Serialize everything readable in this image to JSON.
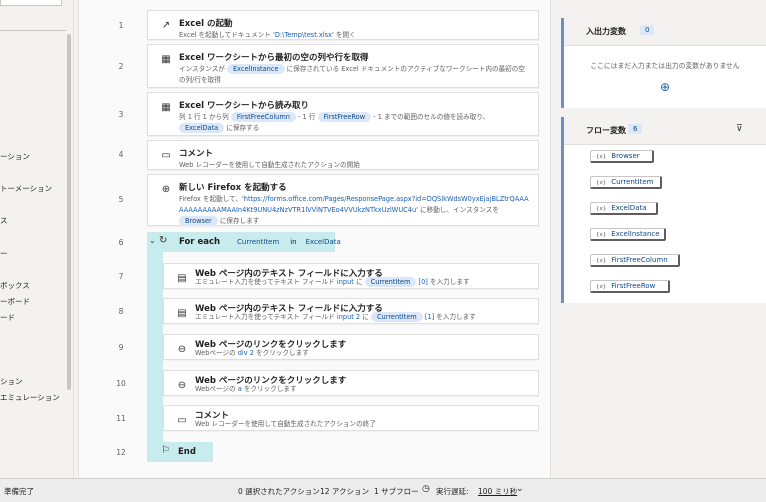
{
  "left_panel": {
    "items": [
      "ーション",
      "トーメーション",
      "ス",
      "ー",
      "ボックス",
      "ーボード",
      "ード",
      "ション",
      "エミュレーション"
    ]
  },
  "flow": {
    "steps": [
      {
        "num": "1",
        "title": "Excel の起動",
        "desc_parts": [
          "Excel を起動してドキュメント ",
          "'D:\\Temp\\test.xlsx'",
          " を開く"
        ]
      },
      {
        "num": "2",
        "title": "Excel ワークシートから最初の空の列や行を取得",
        "desc_a": "インスタンスが ",
        "tok1": "ExcelInstance",
        "desc_b": " に保存されている Excel ドキュメントのアクティブなワークシート内の最初の空の列/行を取得"
      },
      {
        "num": "3",
        "title": "Excel ワークシートから読み取り",
        "desc_a": "列 1 行 1 から列 ",
        "tok1": "FirstFreeColumn",
        "desc_b": " - 1 行 ",
        "tok2": "FirstFreeRow",
        "desc_c": " - 1 までの範囲のセルの値を読み取り、",
        "tok3": "ExcelData",
        "desc_d": " に保存する"
      },
      {
        "num": "4",
        "title": "コメント",
        "desc": "Web レコーダーを使用して自動生成されたアクションの開始"
      },
      {
        "num": "5",
        "title": "新しい Firefox を起動する",
        "desc_a": "Firefox を起動して、",
        "link": "'https://forms.office.com/Pages/ResponsePage.aspx?id=DQSIkWdsW0yxEjajBLZtrQAAAAAAAAAAAAMAAIn4Kt9UNU4zNzVTR1lVVlNTVEo4VVUkzNTkxUzlWUC4u'",
        "desc_b": " に移動し、インスタンスを ",
        "tok1": "Browser",
        "desc_c": " に保存します"
      },
      {
        "num": "6",
        "kw": "For each",
        "tok1": "CurrentItem",
        "in": "in",
        "tok2": "ExcelData"
      },
      {
        "num": "7",
        "title": "Web ページ内のテキスト フィールドに入力する",
        "desc_a": "エミュレート入力を使ってテキスト フィールド ",
        "link": "input",
        "desc_b": " に ",
        "tok1": "CurrentItem",
        "link2": "[0]",
        "desc_c": " を入力します"
      },
      {
        "num": "8",
        "title": "Web ページ内のテキスト フィールドに入力する",
        "desc_a": "エミュレート入力を使ってテキスト フィールド ",
        "link": "input 2",
        "desc_b": " に ",
        "tok1": "CurrentItem",
        "link2": "[1]",
        "desc_c": " を入力します"
      },
      {
        "num": "9",
        "title": "Web ページのリンクをクリックします",
        "desc_a": "Webページの ",
        "link": "div 2",
        "desc_b": " をクリックします"
      },
      {
        "num": "10",
        "title": "Web ページのリンクをクリックします",
        "desc_a": "Webページの ",
        "link": "a",
        "desc_b": " をクリックします"
      },
      {
        "num": "11",
        "title": "コメント",
        "desc": "Web レコーダーを使用して自動生成されたアクションの終了"
      },
      {
        "num": "12",
        "kw": "End"
      }
    ]
  },
  "io_vars": {
    "title": "入出力変数",
    "count": "0",
    "empty_text": "ここにはまだ入力または出力の変数がありません"
  },
  "flow_vars": {
    "title": "フロー変数",
    "count": "6",
    "symbol": "{x}",
    "items": [
      "Browser",
      "CurrentItem",
      "ExcelData",
      "ExcelInstance",
      "FirstFreeColumn",
      "FirstFreeRow"
    ]
  },
  "status": {
    "left": "準備完了",
    "selected": "0 選択されたアクション",
    "actions": "12 アクション",
    "subflows": "1 サブフロー",
    "delay_label": "実行遅延:",
    "delay_value": "100 ミリ秒"
  }
}
